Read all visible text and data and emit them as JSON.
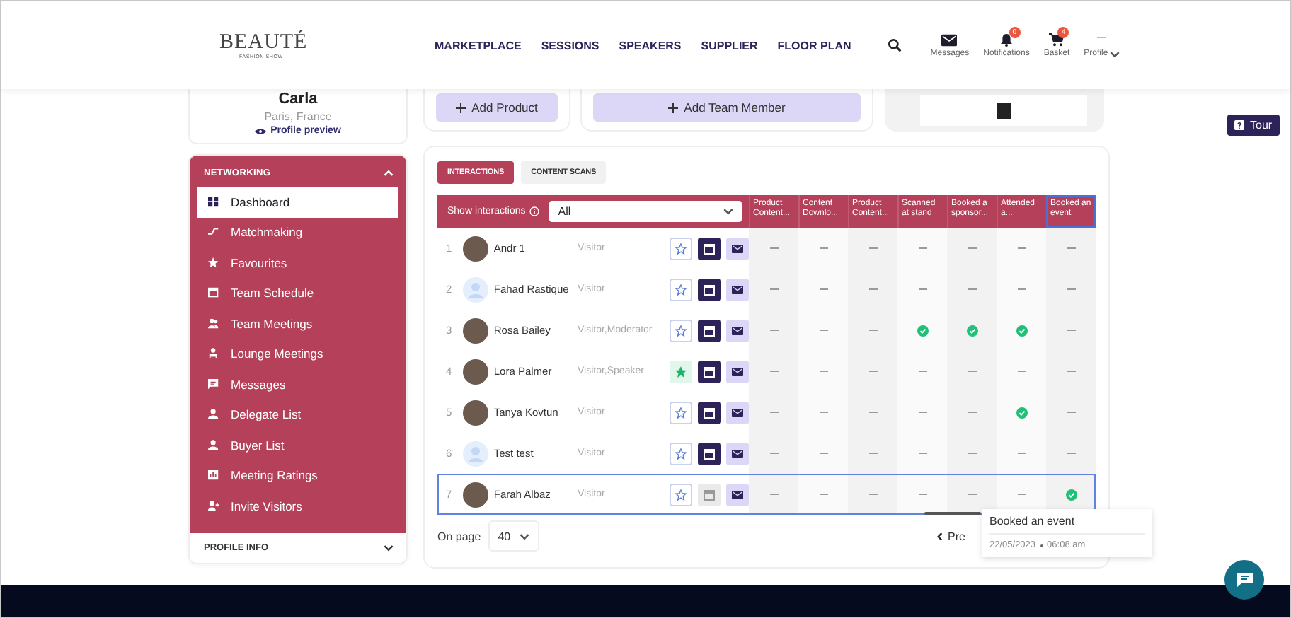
{
  "header": {
    "logo": "BEAUTÉ",
    "logo_tagline": "FASHION SHOW",
    "nav": [
      "MARKETPLACE",
      "SESSIONS",
      "SPEAKERS",
      "SUPPLIER",
      "FLOOR PLAN"
    ],
    "actions": [
      {
        "kind": "messages",
        "label": "Messages"
      },
      {
        "kind": "notifications",
        "label": "Notifications",
        "badge": "0"
      },
      {
        "kind": "basket",
        "label": "Basket",
        "badge": "4"
      },
      {
        "kind": "profile",
        "label": "Profile"
      }
    ]
  },
  "profile": {
    "name": "Carla",
    "location": "Paris, France",
    "link": "Profile preview"
  },
  "sidebar": {
    "title": "NETWORKING",
    "expanded": true,
    "items": [
      {
        "label": "Dashboard",
        "selected": true
      },
      {
        "label": "Matchmaking",
        "selected": false
      },
      {
        "label": "Favourites",
        "selected": false
      },
      {
        "label": "Team Schedule",
        "selected": false
      },
      {
        "label": "Team Meetings",
        "selected": false
      },
      {
        "label": "Lounge Meetings",
        "selected": false
      },
      {
        "label": "Messages",
        "selected": false
      },
      {
        "label": "Delegate List",
        "selected": false
      },
      {
        "label": "Buyer List",
        "selected": false
      },
      {
        "label": "Meeting Ratings",
        "selected": false
      },
      {
        "label": "Invite Visitors",
        "selected": false
      }
    ],
    "footer": {
      "title": "PROFILE INFO",
      "expanded": false
    }
  },
  "top_cards": {
    "buttons": [
      "Add Product",
      "Add Team Member"
    ]
  },
  "interactions": {
    "tabs": [
      {
        "label": "INTERACTIONS",
        "selected": true
      },
      {
        "label": "CONTENT SCANS",
        "selected": false
      }
    ],
    "filter": {
      "label": "Show interactions",
      "value": "All"
    },
    "columns": [
      {
        "label": "Product Content...",
        "highlighted": false
      },
      {
        "label": "Content Downlo...",
        "highlighted": false
      },
      {
        "label": "Product Content...",
        "highlighted": false
      },
      {
        "label": "Scanned at stand",
        "highlighted": false
      },
      {
        "label": "Booked a sponsor...",
        "highlighted": false
      },
      {
        "label": "Attended a...",
        "highlighted": false
      },
      {
        "label": "Booked an event",
        "highlighted": true
      }
    ],
    "rows": [
      {
        "number": "1",
        "name": "Andr 1",
        "role": "Visitor",
        "photo": true,
        "favourite": false,
        "meeting_available": true,
        "highlighted": false,
        "cells": [
          false,
          false,
          false,
          false,
          false,
          false,
          false
        ]
      },
      {
        "number": "2",
        "name": "Fahad Rastique",
        "role": "Visitor",
        "photo": false,
        "favourite": false,
        "meeting_available": true,
        "highlighted": false,
        "cells": [
          false,
          false,
          false,
          false,
          false,
          false,
          false
        ]
      },
      {
        "number": "3",
        "name": "Rosa Bailey",
        "role": "Visitor,Moderator",
        "photo": true,
        "favourite": false,
        "meeting_available": true,
        "highlighted": false,
        "cells": [
          false,
          false,
          false,
          true,
          true,
          true,
          false
        ]
      },
      {
        "number": "4",
        "name": "Lora Palmer",
        "role": "Visitor,Speaker",
        "photo": true,
        "favourite": true,
        "meeting_available": true,
        "highlighted": false,
        "cells": [
          false,
          false,
          false,
          false,
          false,
          false,
          false
        ]
      },
      {
        "number": "5",
        "name": "Tanya Kovtun",
        "role": "Visitor",
        "photo": true,
        "favourite": false,
        "meeting_available": true,
        "highlighted": false,
        "cells": [
          false,
          false,
          false,
          false,
          false,
          true,
          false
        ]
      },
      {
        "number": "6",
        "name": "Test test",
        "role": "Visitor",
        "photo": false,
        "favourite": false,
        "meeting_available": true,
        "highlighted": false,
        "cells": [
          false,
          false,
          false,
          false,
          false,
          false,
          false
        ]
      },
      {
        "number": "7",
        "name": "Farah Albaz",
        "role": "Visitor",
        "photo": true,
        "favourite": false,
        "meeting_available": false,
        "highlighted": true,
        "cells": [
          false,
          false,
          false,
          false,
          false,
          false,
          true
        ]
      }
    ],
    "pagination": {
      "label": "On page",
      "per_page": "40",
      "previous": "Pre"
    },
    "tooltip": {
      "title": "Booked an event",
      "date": "22/05/2023",
      "time": "06:08 am"
    }
  },
  "tour_button": "Tour"
}
